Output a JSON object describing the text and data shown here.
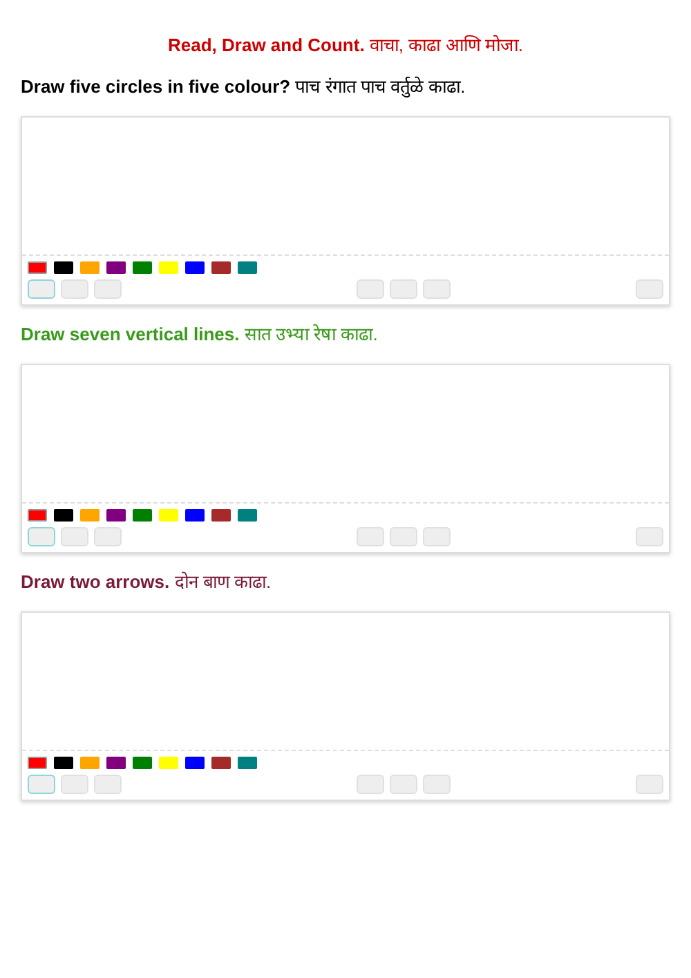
{
  "title": "**Read, Draw and Count.** वाचा, काढा आणि मोजा.",
  "questions": [
    {
      "text": "**Draw five circles in five colour?** पाच रंगात पाच वर्तुळे काढा.",
      "color": "#000000",
      "swatches": [
        {
          "color": "#ff0000",
          "selected": true
        },
        {
          "color": "#000000",
          "selected": false
        },
        {
          "color": "#ffa500",
          "selected": false
        },
        {
          "color": "#800080",
          "selected": false
        },
        {
          "color": "#008000",
          "selected": false
        },
        {
          "color": "#ffff00",
          "selected": false
        },
        {
          "color": "#0000ff",
          "selected": false
        },
        {
          "color": "#a52a2a",
          "selected": false
        },
        {
          "color": "#008080",
          "selected": false
        }
      ],
      "tool_groups": [
        [
          {
            "selected": true
          },
          {
            "selected": false
          },
          {
            "selected": false
          }
        ],
        [
          {
            "selected": false
          },
          {
            "selected": false
          },
          {
            "selected": false
          }
        ],
        [
          {
            "selected": false
          }
        ]
      ]
    },
    {
      "text": "**Draw seven vertical lines.** सात उभ्या रेषा काढा.",
      "color": "#3a9a1a",
      "swatches": [
        {
          "color": "#ff0000",
          "selected": true
        },
        {
          "color": "#000000",
          "selected": false
        },
        {
          "color": "#ffa500",
          "selected": false
        },
        {
          "color": "#800080",
          "selected": false
        },
        {
          "color": "#008000",
          "selected": false
        },
        {
          "color": "#ffff00",
          "selected": false
        },
        {
          "color": "#0000ff",
          "selected": false
        },
        {
          "color": "#a52a2a",
          "selected": false
        },
        {
          "color": "#008080",
          "selected": false
        }
      ],
      "tool_groups": [
        [
          {
            "selected": true
          },
          {
            "selected": false
          },
          {
            "selected": false
          }
        ],
        [
          {
            "selected": false
          },
          {
            "selected": false
          },
          {
            "selected": false
          }
        ],
        [
          {
            "selected": false
          }
        ]
      ]
    },
    {
      "text": "**Draw two arrows.** दोन बाण काढा.",
      "color": "#7a1a3a",
      "swatches": [
        {
          "color": "#ff0000",
          "selected": true
        },
        {
          "color": "#000000",
          "selected": false
        },
        {
          "color": "#ffa500",
          "selected": false
        },
        {
          "color": "#800080",
          "selected": false
        },
        {
          "color": "#008000",
          "selected": false
        },
        {
          "color": "#ffff00",
          "selected": false
        },
        {
          "color": "#0000ff",
          "selected": false
        },
        {
          "color": "#a52a2a",
          "selected": false
        },
        {
          "color": "#008080",
          "selected": false
        }
      ],
      "tool_groups": [
        [
          {
            "selected": true
          },
          {
            "selected": false
          },
          {
            "selected": false
          }
        ],
        [
          {
            "selected": false
          },
          {
            "selected": false
          },
          {
            "selected": false
          }
        ],
        [
          {
            "selected": false
          }
        ]
      ]
    }
  ]
}
